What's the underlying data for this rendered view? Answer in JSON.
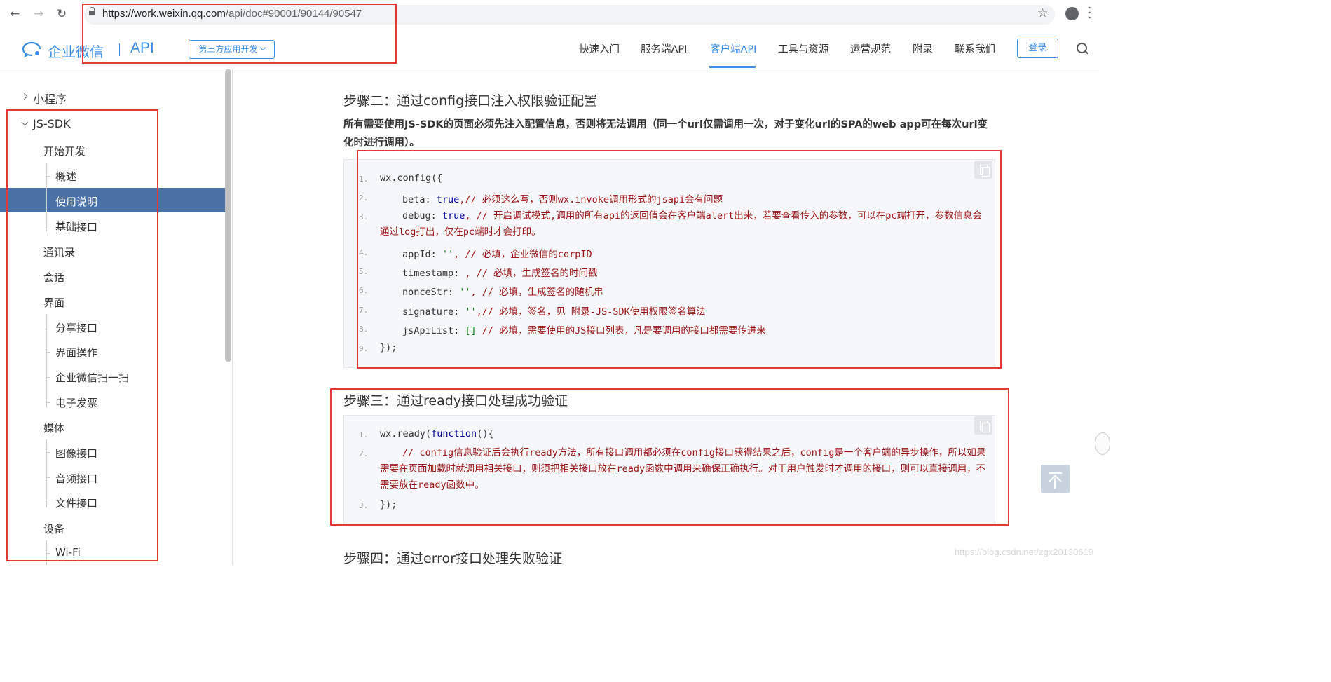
{
  "browser": {
    "url_host": "https://work.weixin.qq.com",
    "url_path": "/api/doc#90001/90144/90547",
    "back": "←",
    "forward": "→",
    "reload": "↻",
    "star": "☆",
    "menu": "⋮"
  },
  "header": {
    "logo_text": "企业微信",
    "logo_api": "API",
    "dropdown_label": "第三方应用开发",
    "nav": [
      "快速入门",
      "服务端API",
      "客户端API",
      "工具与资源",
      "运营规范",
      "附录",
      "联系我们"
    ],
    "active_nav": "客户端API",
    "login_label": "登录",
    "accent_color": "#3a8ee6"
  },
  "sidebar": {
    "items": [
      "小程序",
      "JS-SDK",
      "开始开发",
      "概述",
      "使用说明",
      "基础接口",
      "通讯录",
      "会话",
      "界面",
      "分享接口",
      "界面操作",
      "企业微信扫一扫",
      "电子发票",
      "媒体",
      "图像接口",
      "音频接口",
      "文件接口",
      "设备",
      "Wi-Fi"
    ],
    "active_item": "使用说明",
    "active_color": "#4a72a6"
  },
  "content": {
    "step2_title": "步骤二：通过config接口注入权限验证配置",
    "step2_note": "所有需要使用JS-SDK的页面必须先注入配置信息，否则将无法调用（同一个url仅需调用一次，对于变化url的SPA的web app可在每次url变化时进行调用）。",
    "code1": {
      "line_numbers": [
        "1.",
        "2.",
        "3.",
        "4.",
        "5.",
        "6.",
        "7.",
        "8.",
        "9."
      ],
      "l1_obj": "wx.config({",
      "l2_key": "beta: ",
      "l2_val": "true",
      "l2_comment": ",// 必须这么写，否则wx.invoke调用形式的jsapi会有问题",
      "l3_key": "debug: ",
      "l3_val": "true",
      "l3_comment": ", // 开启调试模式,调用的所有api的返回值会在客户端alert出来，若要查看传入的参数，可以在pc端打开，参数信息会通过log打出，仅在pc端时才会打印。",
      "l4_key": "appId: ",
      "l4_val": "''",
      "l4_comment": ", // 必填，企业微信的corpID",
      "l5_key": "timestamp: ",
      "l5_comment": ", // 必填，生成签名的时间戳",
      "l6_key": "nonceStr: ",
      "l6_val": "''",
      "l6_comment": ", // 必填，生成签名的随机串",
      "l7_key": "signature: ",
      "l7_val": "''",
      "l7_comment": ",// 必填，签名，见 附录-JS-SDK使用权限签名算法",
      "l8_key": "jsApiList: ",
      "l8_val": "[]",
      "l8_comment": " // 必填，需要使用的JS接口列表，凡是要调用的接口都需要传进来",
      "l9": "});"
    },
    "step3_title": "步骤三：通过ready接口处理成功验证",
    "code2": {
      "line_numbers": [
        "1.",
        "2.",
        "3."
      ],
      "l1_obj": "wx.ready(",
      "l1_kw": "function",
      "l1_rest": "(){",
      "l2_comment": "// config信息验证后会执行ready方法，所有接口调用都必须在config接口获得结果之后，config是一个客户端的异步操作，所以如果需要在页面加载时就调用相关接口，则须把相关接口放在ready函数中调用来确保正确执行。对于用户触发时才调用的接口，则可以直接调用，不需要放在ready函数中。",
      "l3": "});"
    },
    "step4_title": "步骤四：通过error接口处理失败验证"
  },
  "watermark": "https://blog.csdn.net/zgx20130619"
}
